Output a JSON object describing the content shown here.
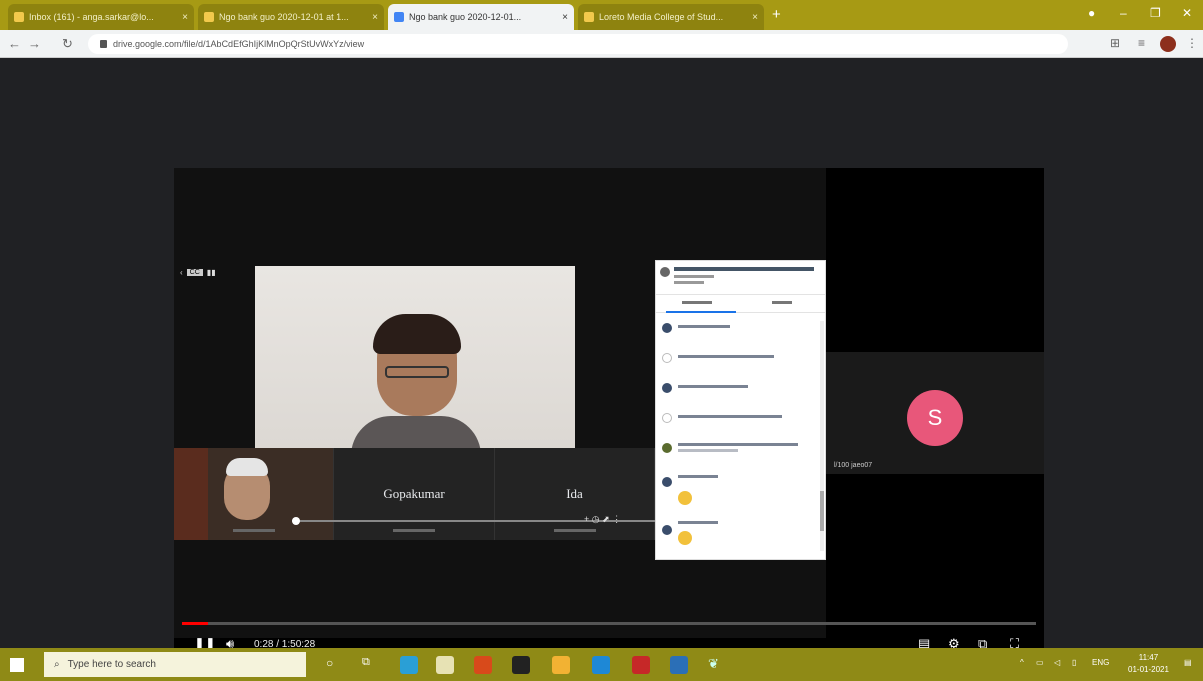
{
  "browser": {
    "tabs": [
      {
        "label": "Inbox (161) - anga.sarkar@lo..."
      },
      {
        "label": "Ngo bank guo 2020-12-01 at 1..."
      },
      {
        "label": "Ngo bank guo 2020-12-01..."
      },
      {
        "label": "Loreto Media College of Stud..."
      }
    ],
    "url": "drive.google.com/file/d/1AbCdEfGhIjKlMnOpQrStUvWxYz/view"
  },
  "player": {
    "tiles": [
      {
        "name": ""
      },
      {
        "name": "Gopakumar"
      },
      {
        "name": "Ida"
      }
    ],
    "right_avatar_initial": "S",
    "right_tile_name": "l/100 jaeo07",
    "time_display": "0:28 / 1:50:28",
    "progress_fraction": 0.03
  },
  "taskbar": {
    "search_placeholder": "Type here to search",
    "clock_time": "11:47",
    "clock_date": "01-01-2021",
    "lang": "ENG"
  },
  "colors": {
    "tab_bar": "#a79a14",
    "taskbar": "#8f8a16",
    "avatar": "#e8577a",
    "progress": "#ff0000"
  }
}
